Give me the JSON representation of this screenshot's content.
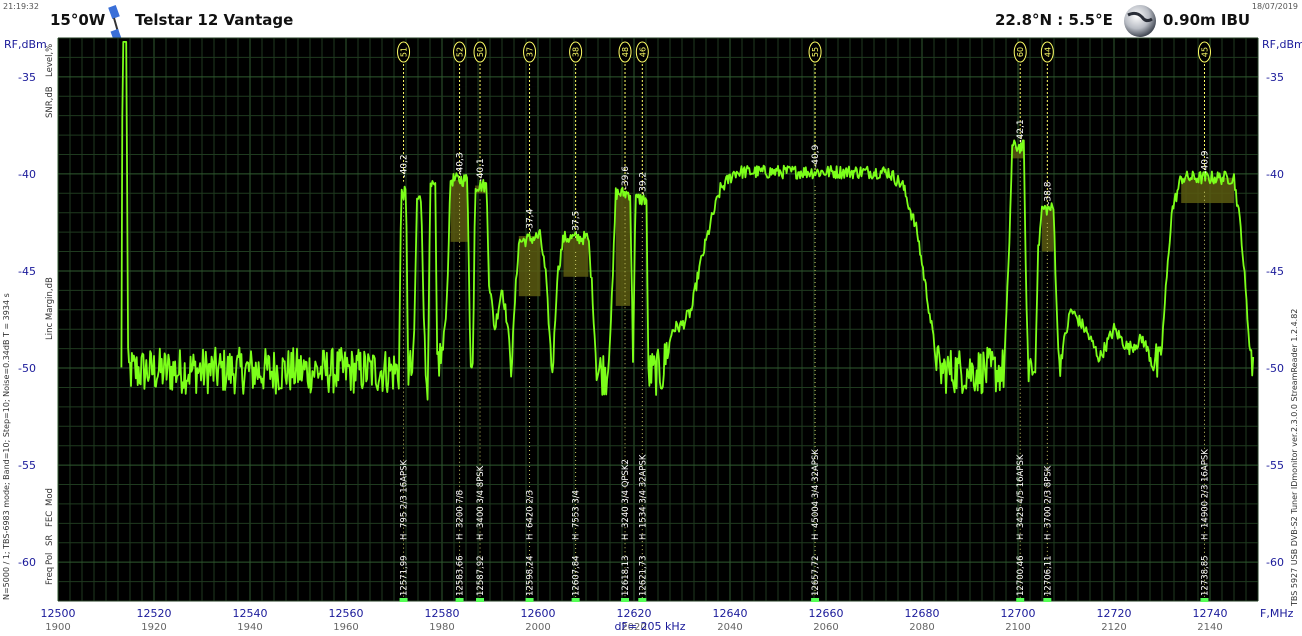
{
  "header": {
    "time": "21:19:32",
    "date": "18/07/2019",
    "sat_position": "15°0W",
    "sat_name": "Telstar 12 Vantage",
    "site_coords": "22.8°N : 5.5°E",
    "dish": "0.90m  IBU"
  },
  "axis_labels": {
    "y_unit_left": "RF,dBm",
    "y_unit_right": "RF,dBm",
    "x_unit": "F,MHz",
    "dF": "dF= 205 kHz"
  },
  "left_rotated_top": [
    "Level,%",
    "SNR,dB"
  ],
  "left_rotated_mid": "Linc Margin,dB",
  "left_rotated_bottom": [
    "Freq",
    "Pol",
    "SR",
    "FEC",
    "Mod"
  ],
  "left_status": "N=5000 / 1; TBS-6983 mode; Band=10; Step=10; Noise=0.34dB   T = 3934 s",
  "right_status": "TBS 5927 USB DVB-S2 Tuner   IDmonitor  ver.2.3.0.0  StreamReader 1.2.4.82",
  "colors": {
    "background": "#000000",
    "grid": "#1f3a1f",
    "trace": "#7cff1a",
    "fill": "#5a5a10",
    "marker": "#ffff66",
    "axis_text": "#1a1a9a"
  },
  "chart_data": {
    "type": "line",
    "xlabel": "F,MHz",
    "ylabel": "RF,dBm",
    "xlim": [
      12500,
      12750
    ],
    "ylim": [
      -62,
      -33
    ],
    "x_ticks": [
      12500,
      12520,
      12540,
      12560,
      12580,
      12600,
      12620,
      12640,
      12660,
      12680,
      12700,
      12720,
      12740
    ],
    "if_ticks": [
      "1900",
      "1920",
      "1940",
      "1960",
      "1980",
      "2000",
      "2020",
      "2040",
      "2060",
      "2080",
      "2100",
      "2120",
      "2140"
    ],
    "y_ticks": [
      -35,
      -40,
      -45,
      -50,
      -55,
      -60
    ],
    "grid": true,
    "noise_floor": -50.5,
    "spectrum_points": [
      [
        12513.2,
        -50.7
      ],
      [
        12513.5,
        -30
      ],
      [
        12514.2,
        -30
      ],
      [
        12514.6,
        -50.5
      ],
      [
        12571.0,
        -50.5
      ],
      [
        12571.5,
        -41.0
      ],
      [
        12572.5,
        -41.0
      ],
      [
        12573.0,
        -50.5
      ],
      [
        12574.0,
        -50.5
      ],
      [
        12574.8,
        -41.3
      ],
      [
        12575.7,
        -41.3
      ],
      [
        12576.5,
        -50.7
      ],
      [
        12577.0,
        -50.8
      ],
      [
        12577.6,
        -40.7
      ],
      [
        12578.6,
        -40.7
      ],
      [
        12579.0,
        -50.0
      ],
      [
        12580.0,
        -49.7
      ],
      [
        12581.0,
        -46.5
      ],
      [
        12581.8,
        -40.3
      ],
      [
        12585.3,
        -40.3
      ],
      [
        12586.0,
        -50.5
      ],
      [
        12586.4,
        -50.5
      ],
      [
        12586.9,
        -40.6
      ],
      [
        12589.3,
        -40.6
      ],
      [
        12589.8,
        -45.5
      ],
      [
        12591.0,
        -48.0
      ],
      [
        12592.5,
        -45.8
      ],
      [
        12593.5,
        -47.5
      ],
      [
        12594.5,
        -50.0
      ],
      [
        12595.2,
        -46.5
      ],
      [
        12596.0,
        -43.5
      ],
      [
        12600.5,
        -43.2
      ],
      [
        12601.6,
        -45.2
      ],
      [
        12603.0,
        -50.5
      ],
      [
        12604.0,
        -45.3
      ],
      [
        12605.3,
        -43.3
      ],
      [
        12610.5,
        -43.3
      ],
      [
        12611.3,
        -46.0
      ],
      [
        12612.3,
        -50.5
      ],
      [
        12614.5,
        -50.6
      ],
      [
        12615.5,
        -46.0
      ],
      [
        12616.2,
        -41.0
      ],
      [
        12619.2,
        -41.0
      ],
      [
        12619.8,
        -49.5
      ],
      [
        12620.3,
        -41.3
      ],
      [
        12622.6,
        -41.3
      ],
      [
        12623.0,
        -50.6
      ],
      [
        12626.0,
        -50.6
      ],
      [
        12628.0,
        -48.0
      ],
      [
        12630.0,
        -47.8
      ],
      [
        12632.0,
        -47.0
      ],
      [
        12633.5,
        -45.0
      ],
      [
        12636.0,
        -42.5
      ],
      [
        12638.0,
        -40.8
      ],
      [
        12641.0,
        -39.9
      ],
      [
        12673.0,
        -39.9
      ],
      [
        12676.0,
        -40.6
      ],
      [
        12679.0,
        -43.0
      ],
      [
        12681.5,
        -47.0
      ],
      [
        12683.5,
        -50.5
      ],
      [
        12697.0,
        -50.5
      ],
      [
        12698.0,
        -45.0
      ],
      [
        12698.8,
        -38.6
      ],
      [
        12701.2,
        -38.6
      ],
      [
        12702.0,
        -50.0
      ],
      [
        12703.5,
        -50.6
      ],
      [
        12704.2,
        -44.0
      ],
      [
        12705.0,
        -41.8
      ],
      [
        12707.4,
        -41.8
      ],
      [
        12708.5,
        -50.0
      ],
      [
        12711.0,
        -47.0
      ],
      [
        12714.0,
        -48.0
      ],
      [
        12717.0,
        -49.5
      ],
      [
        12720.0,
        -48.0
      ],
      [
        12723.0,
        -49.0
      ],
      [
        12726.0,
        -48.5
      ],
      [
        12729.5,
        -50.6
      ],
      [
        12730.5,
        -47.0
      ],
      [
        12732.0,
        -42.0
      ],
      [
        12734.0,
        -40.2
      ],
      [
        12745.0,
        -40.2
      ],
      [
        12746.5,
        -43.0
      ],
      [
        12748.0,
        -48.0
      ],
      [
        12749.0,
        -50.8
      ]
    ],
    "transponders": [
      {
        "num": "51",
        "x": 12571.99,
        "peak": "-40,2",
        "peak_y": -40.4,
        "line1": "795 2/3 16APSK",
        "freq": "12571,99 H"
      },
      {
        "num": "52",
        "x": 12583.66,
        "peak": "-40,3",
        "peak_y": -40.3,
        "line1": "3200 7/8",
        "freq": "12583,66 H",
        "band": [
          12581.8,
          12585.3
        ],
        "band_lo": -43.5
      },
      {
        "num": "50",
        "x": 12587.92,
        "peak": "-40,1",
        "peak_y": -40.6,
        "line1": "3400 3/4 8PSK",
        "freq": "12587,92 H",
        "band": [
          12586.9,
          12589.3
        ],
        "band_lo": -41.0
      },
      {
        "num": "37",
        "x": 12598.24,
        "peak": "-37,4",
        "peak_y": -43.2,
        "line1": "6420 2/3",
        "freq": "12598,24 H",
        "band": [
          12596.0,
          12600.5
        ],
        "band_lo": -46.3
      },
      {
        "num": "38",
        "x": 12607.84,
        "peak": "-37,5",
        "peak_y": -43.3,
        "line1": "7553 3/4",
        "freq": "12607,84 H",
        "band": [
          12605.3,
          12610.5
        ],
        "band_lo": -45.3
      },
      {
        "num": "48",
        "x": 12618.13,
        "peak": "-39,6",
        "peak_y": -41.0,
        "line1": "3240 3/4 QPSK2",
        "freq": "12618,13 H",
        "band": [
          12616.2,
          12619.2
        ],
        "band_lo": -46.8
      },
      {
        "num": "46",
        "x": 12621.73,
        "peak": "-39,2",
        "peak_y": -41.3,
        "line1": "1534 3/4 32APSK",
        "freq": "12621,73 H"
      },
      {
        "num": "55",
        "x": 12657.72,
        "peak": "-40,9",
        "peak_y": -39.9,
        "line1": "45004 3/4 32APSK",
        "freq": "12657,72 H"
      },
      {
        "num": "60",
        "x": 12700.46,
        "peak": "-42,1",
        "peak_y": -38.6,
        "line1": "3425 4/5 16APSK",
        "freq": "12700,46 H",
        "band": [
          12698.8,
          12701.2
        ],
        "band_lo": -39.2
      },
      {
        "num": "44",
        "x": 12706.11,
        "peak": "-38,8",
        "peak_y": -41.8,
        "line1": "3700 2/3 8PSK",
        "freq": "12706,11 H",
        "band": [
          12705.0,
          12707.4
        ],
        "band_lo": -44.0
      },
      {
        "num": "45",
        "x": 12738.85,
        "peak": "-40,9",
        "peak_y": -40.2,
        "line1": "14900 2/3 16APSK",
        "freq": "12738,85 H",
        "band": [
          12734.0,
          12745.0
        ],
        "band_lo": -41.5
      }
    ]
  }
}
